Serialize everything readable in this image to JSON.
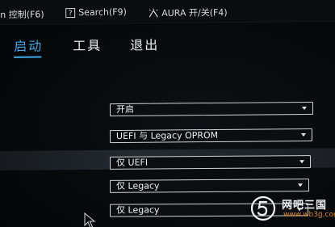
{
  "topbar": {
    "control_label": "in 控制(F6)",
    "search_icon_glyph": "?",
    "search_label": "Search(F9)",
    "aura_label": "AURA 开/关(F4)"
  },
  "tabs": [
    {
      "label": "启动",
      "active": true
    },
    {
      "label": "工具",
      "active": false
    },
    {
      "label": "退出",
      "active": false
    }
  ],
  "settings": [
    {
      "value": "开启"
    },
    {
      "value": "UEFI 与 Legacy OPROM"
    },
    {
      "value": "仅 UEFI",
      "selected": true
    },
    {
      "value": "仅 Legacy"
    },
    {
      "value": "仅 Legacy"
    }
  ],
  "watermark": {
    "name": "网吧三国",
    "url": "www.wb3g.com"
  },
  "colors": {
    "accent": "#3fa9e8",
    "background": "#050608",
    "text": "#e8eaec",
    "watermark_url": "#e08a2a"
  }
}
